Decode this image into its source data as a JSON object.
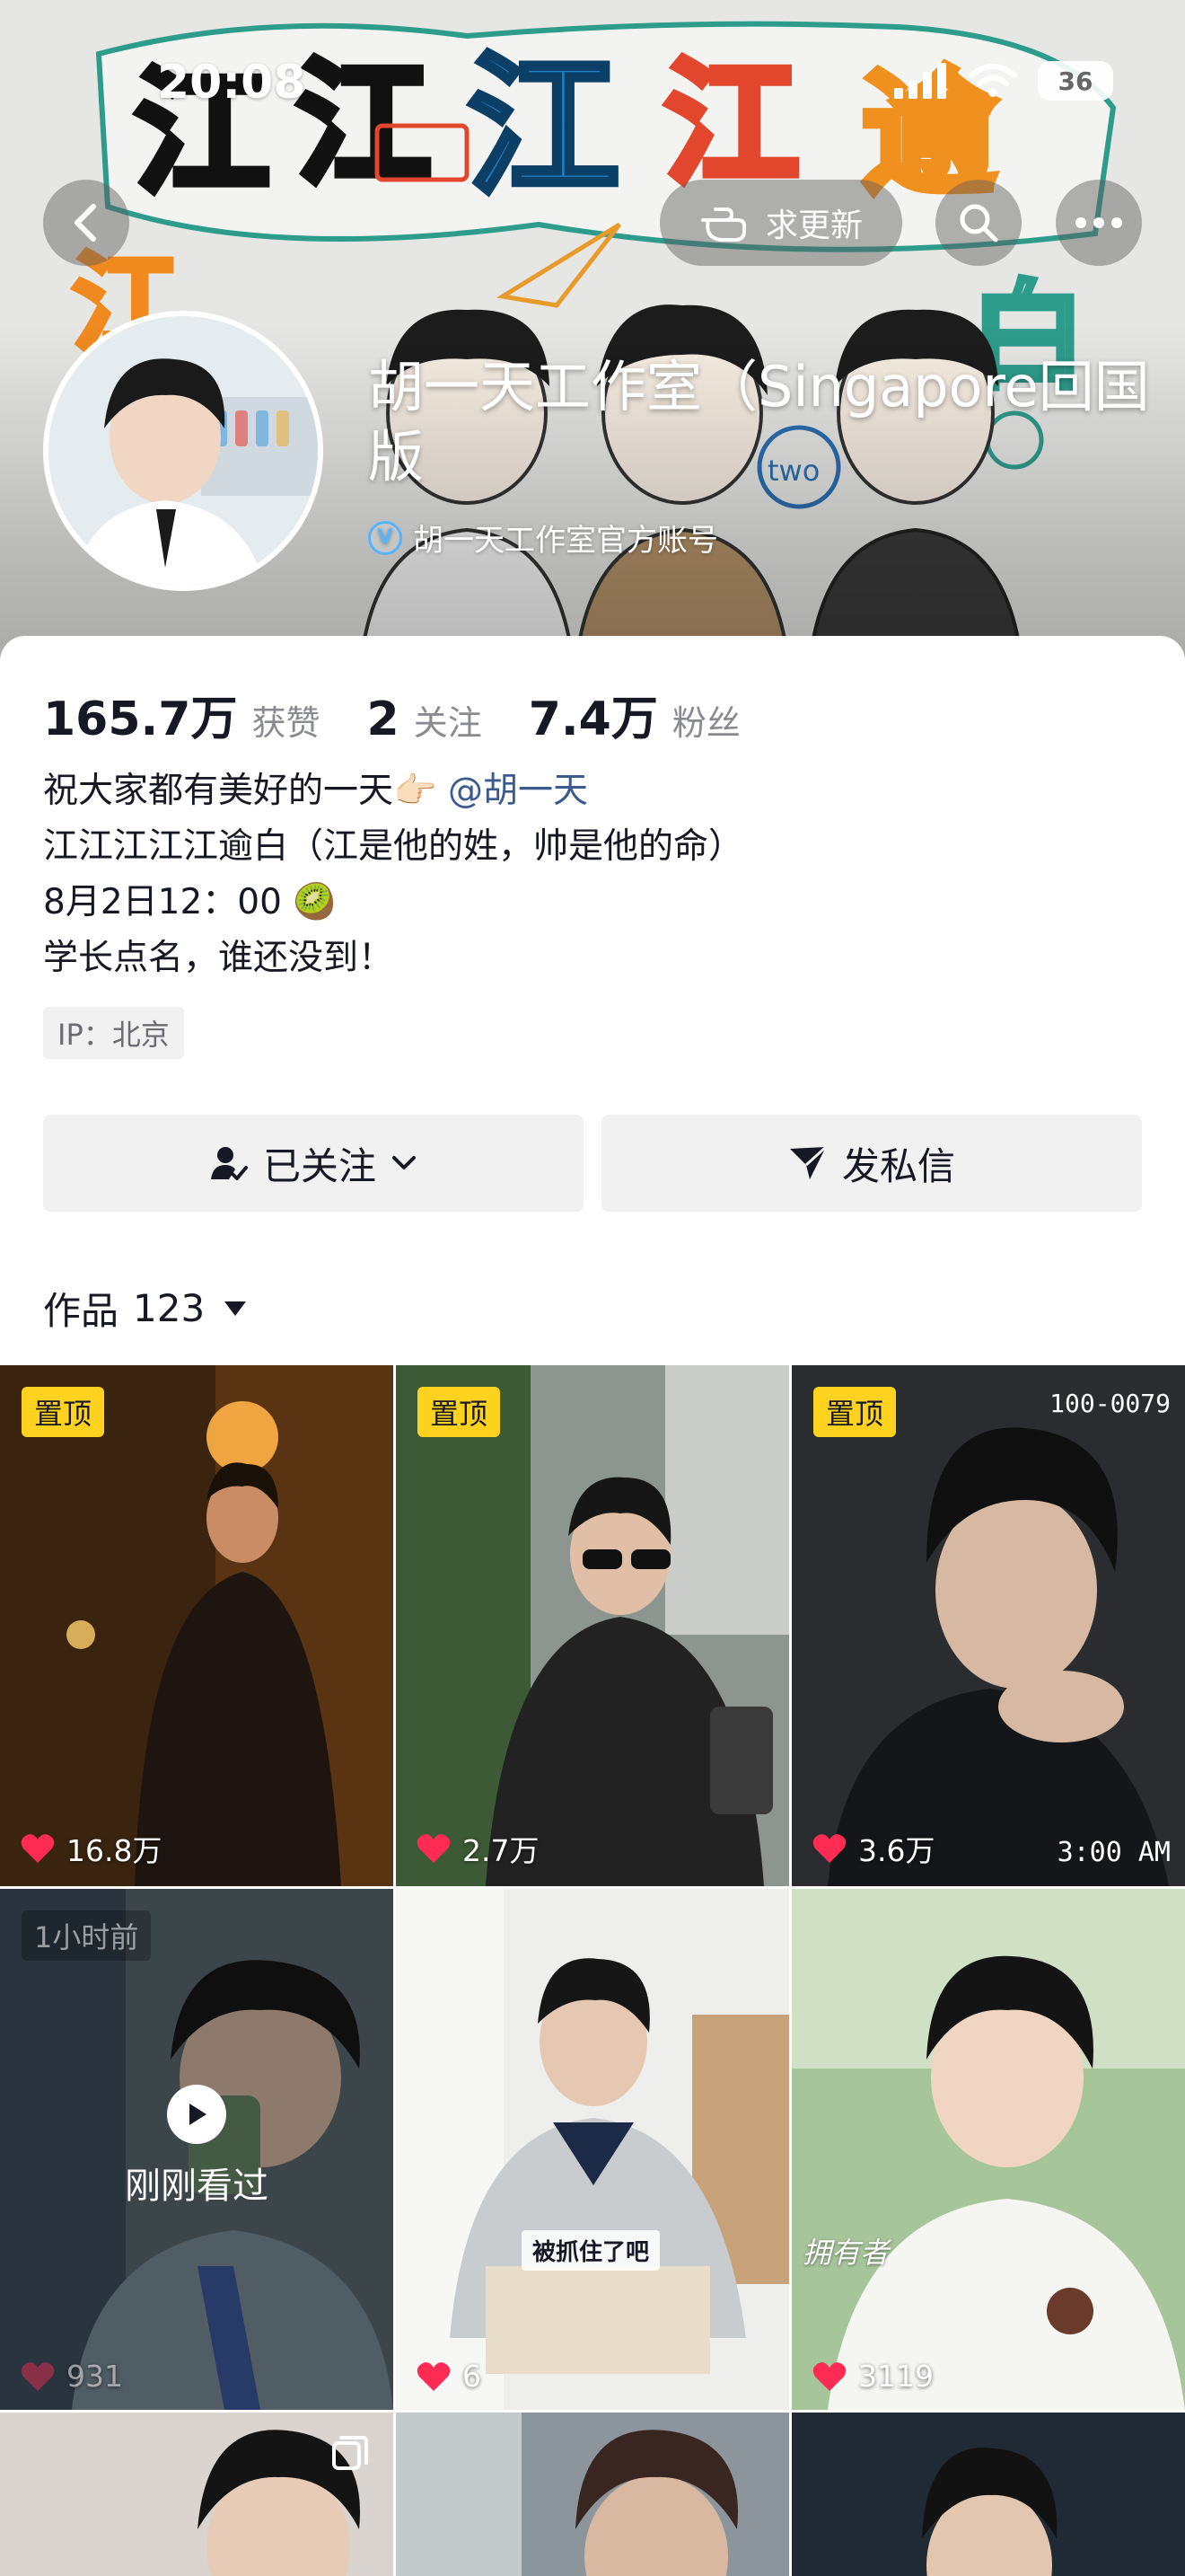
{
  "status_bar": {
    "time": "20:08",
    "battery": "36"
  },
  "nav": {
    "update_label": "求更新"
  },
  "profile": {
    "name": "胡一天工作室（Singapore回国版",
    "verified_label": "胡一天工作室官方账号",
    "verified_badge": "V"
  },
  "stats": [
    {
      "value": "165.7万",
      "label": "获赞"
    },
    {
      "value": "2",
      "label": "关注"
    },
    {
      "value": "7.4万",
      "label": "粉丝"
    }
  ],
  "bio": {
    "line1_text": "祝大家都有美好的一天",
    "line1_emoji": "👉🏻",
    "line1_mention": "@胡一天",
    "line2": "江江江江江逾白（江是他的姓，帅是他的命）",
    "line3_text": "8月2日12：00",
    "line3_emoji": "🥝",
    "line4": "学长点名，谁还没到！"
  },
  "ip_tag": "IP：北京",
  "actions": {
    "follow": "已关注",
    "message": "发私信"
  },
  "works": {
    "label": "作品",
    "count": "123"
  },
  "grid": [
    {
      "pin": "置顶",
      "likes": "16.8万"
    },
    {
      "pin": "置顶",
      "likes": "2.7万"
    },
    {
      "pin": "置顶",
      "likes": "3.6万",
      "code": "100-0079",
      "time": "3:00 AM"
    },
    {
      "ago": "1小时前",
      "watched": "刚刚看过",
      "likes": "931"
    },
    {
      "caption": "被抓住了吧",
      "likes": "6"
    },
    {
      "corner": "拥有者",
      "likes": "3119"
    }
  ],
  "colors": {
    "accent_pin": "#ffd21f",
    "heart": "#fe2c55",
    "mention": "#3b5b8c"
  }
}
